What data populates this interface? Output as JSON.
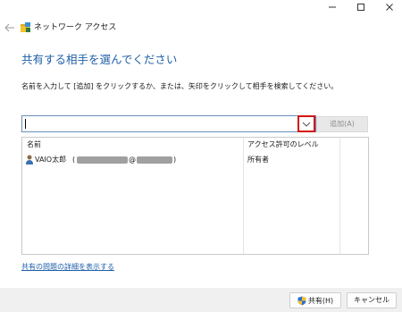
{
  "header": {
    "title": "ネットワーク アクセス"
  },
  "main": {
    "heading": "共有する相手を選んでください",
    "instruction": "名前を入力して [追加] をクリックするか、または、矢印をクリックして相手を検索してください。",
    "name_input": {
      "value": "",
      "placeholder": ""
    },
    "add_button": "追加(A)"
  },
  "list": {
    "columns": [
      "名前",
      "アクセス許可のレベル"
    ],
    "rows": [
      {
        "name": "VAIO太郎",
        "paren_open": "(",
        "at": "@",
        "paren_close": ")",
        "permission": "所有者"
      }
    ]
  },
  "links": {
    "troubleshoot": "共有の問題の詳細を表示する"
  },
  "footer": {
    "share_button": "共有(H)",
    "cancel_button": "キャンセル"
  },
  "colors": {
    "accent": "#1f5fa8",
    "highlight_border": "#d41414"
  }
}
